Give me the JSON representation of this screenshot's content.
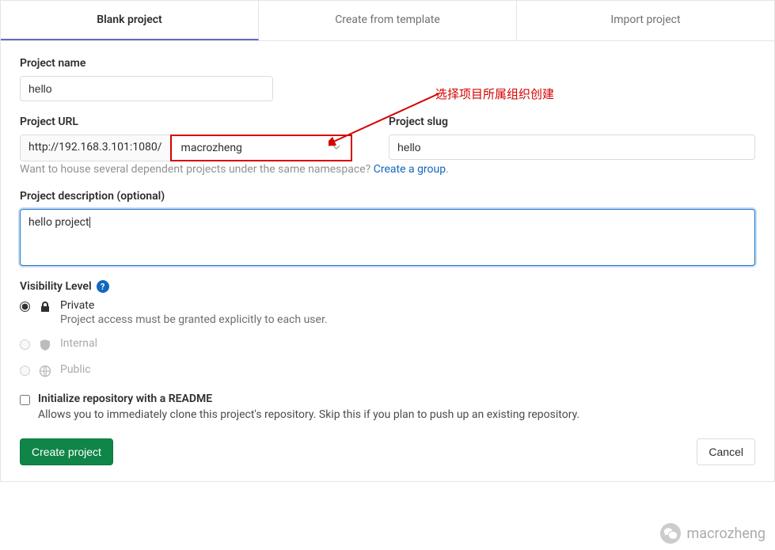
{
  "tabs": {
    "blank": "Blank project",
    "template": "Create from template",
    "import": "Import project"
  },
  "labels": {
    "project_name": "Project name",
    "project_url": "Project URL",
    "project_slug": "Project slug",
    "description": "Project description (optional)",
    "visibility": "Visibility Level"
  },
  "fields": {
    "name_value": "hello",
    "url_prefix": "http://192.168.3.101:1080/",
    "namespace_selected": "macrozheng",
    "slug_value": "hello",
    "description_value": "hello project"
  },
  "help": {
    "namespace": "Want to house several dependent projects under the same namespace? ",
    "namespace_link": "Create a group"
  },
  "visibility": {
    "private": {
      "title": "Private",
      "sub": "Project access must be granted explicitly to each user."
    },
    "internal": {
      "title": "Internal"
    },
    "public": {
      "title": "Public"
    }
  },
  "readme": {
    "title": "Initialize repository with a README",
    "sub": "Allows you to immediately clone this project's repository. Skip this if you plan to push up an existing repository."
  },
  "buttons": {
    "create": "Create project",
    "cancel": "Cancel"
  },
  "annotation": "选择项目所属组织创建",
  "watermark": "macrozheng"
}
